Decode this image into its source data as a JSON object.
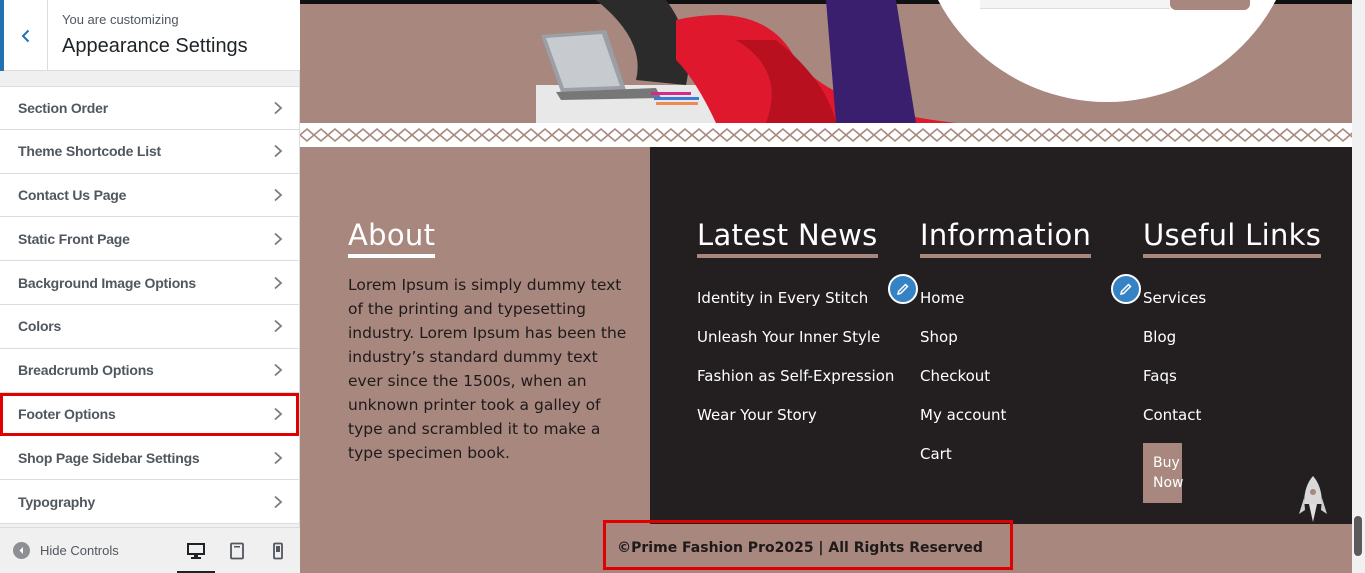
{
  "sidebar": {
    "subtitle": "You are customizing",
    "title": "Appearance Settings",
    "items": [
      {
        "label": "Section Order"
      },
      {
        "label": "Theme Shortcode List"
      },
      {
        "label": "Contact Us Page"
      },
      {
        "label": "Static Front Page"
      },
      {
        "label": "Background Image Options"
      },
      {
        "label": "Colors"
      },
      {
        "label": "Breadcrumb Options"
      },
      {
        "label": "Footer Options"
      },
      {
        "label": "Shop Page Sidebar Settings"
      },
      {
        "label": "Typography"
      }
    ],
    "hide_controls": "Hide Controls",
    "devices": [
      "desktop-icon",
      "tablet-icon",
      "mobile-icon"
    ],
    "highlighted_item": "Footer Options"
  },
  "footer": {
    "about": {
      "title": "About",
      "text": "Lorem Ipsum is simply dummy text of the printing and typesetting industry. Lorem Ipsum has been the industry’s standard dummy text ever since the 1500s, when an unknown printer took a galley of type and scrambled it to make a type specimen book."
    },
    "latest_news": {
      "title": "Latest News",
      "links": [
        "Identity in Every Stitch",
        "Unleash Your Inner Style",
        "Fashion as Self-Expression",
        "Wear Your Story"
      ]
    },
    "information": {
      "title": "Information",
      "links": [
        "Home",
        "Shop",
        "Checkout",
        "My account",
        "Cart"
      ]
    },
    "useful_links": {
      "title": "Useful Links",
      "links": [
        "Services",
        "Blog",
        "Faqs",
        "Contact"
      ],
      "buy_line1": "Buy",
      "buy_line2": "Now"
    },
    "copyright": "©Prime Fashion Pro2025 | All Rights Reserved"
  },
  "colors": {
    "accent": "#2271b1",
    "footer_brown": "#a7877e",
    "footer_dark": "#231f20",
    "highlight_red": "#e00000"
  }
}
